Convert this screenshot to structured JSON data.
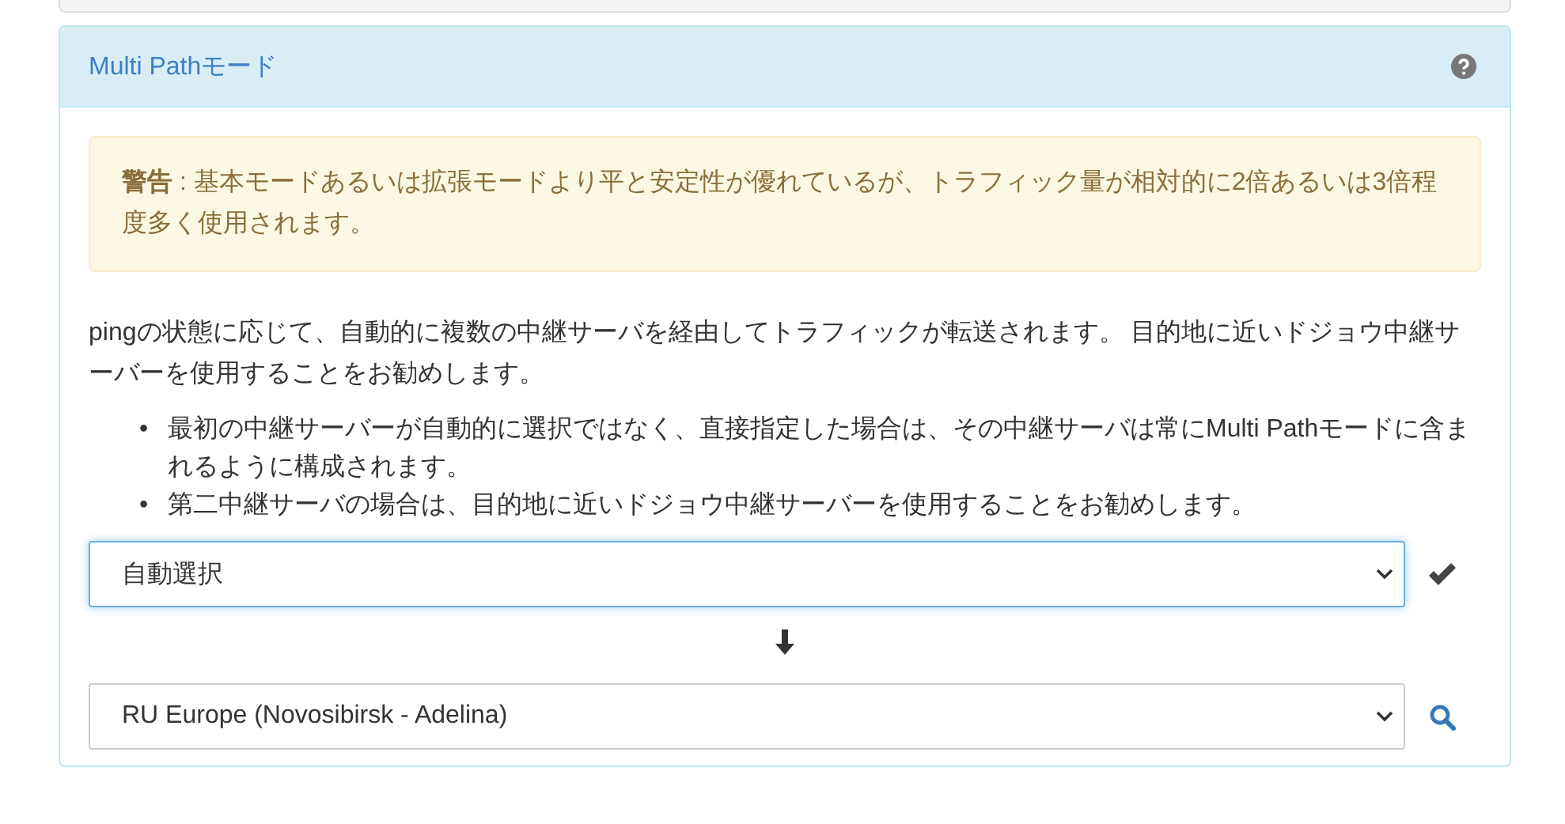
{
  "panel": {
    "title": "Multi Pathモード"
  },
  "warning": {
    "text": "**警告** : 基本モードあるいは拡張モードより平と安定性が優れているが、トラフィック量が相対的に2倍あるいは3倍程度多く使用されます。"
  },
  "description": "pingの状態に応じて、自動的に複数の中継サーバを経由してトラフィックが転送されます。 目的地に近いドジョウ中継サーバーを使用することをお勧めします。",
  "notes": [
    {
      "marker": "•",
      "text": "最初の中継サーバーが自動的に選択ではなく、直接指定した場合は、その中継サーバは常にMulti Pathモードに含まれるように構成されます。"
    },
    {
      "marker": "•",
      "text": "第二中継サーバの場合は、目的地に近いドジョウ中継サーバーを使用することをお勧めします。"
    }
  ],
  "selects": [
    {
      "value": "自動選択",
      "focused": true,
      "kind": "confirm"
    },
    {
      "value": "RU Europe (Novosibirsk - Adelina)",
      "focused": false,
      "kind": "search"
    }
  ]
}
